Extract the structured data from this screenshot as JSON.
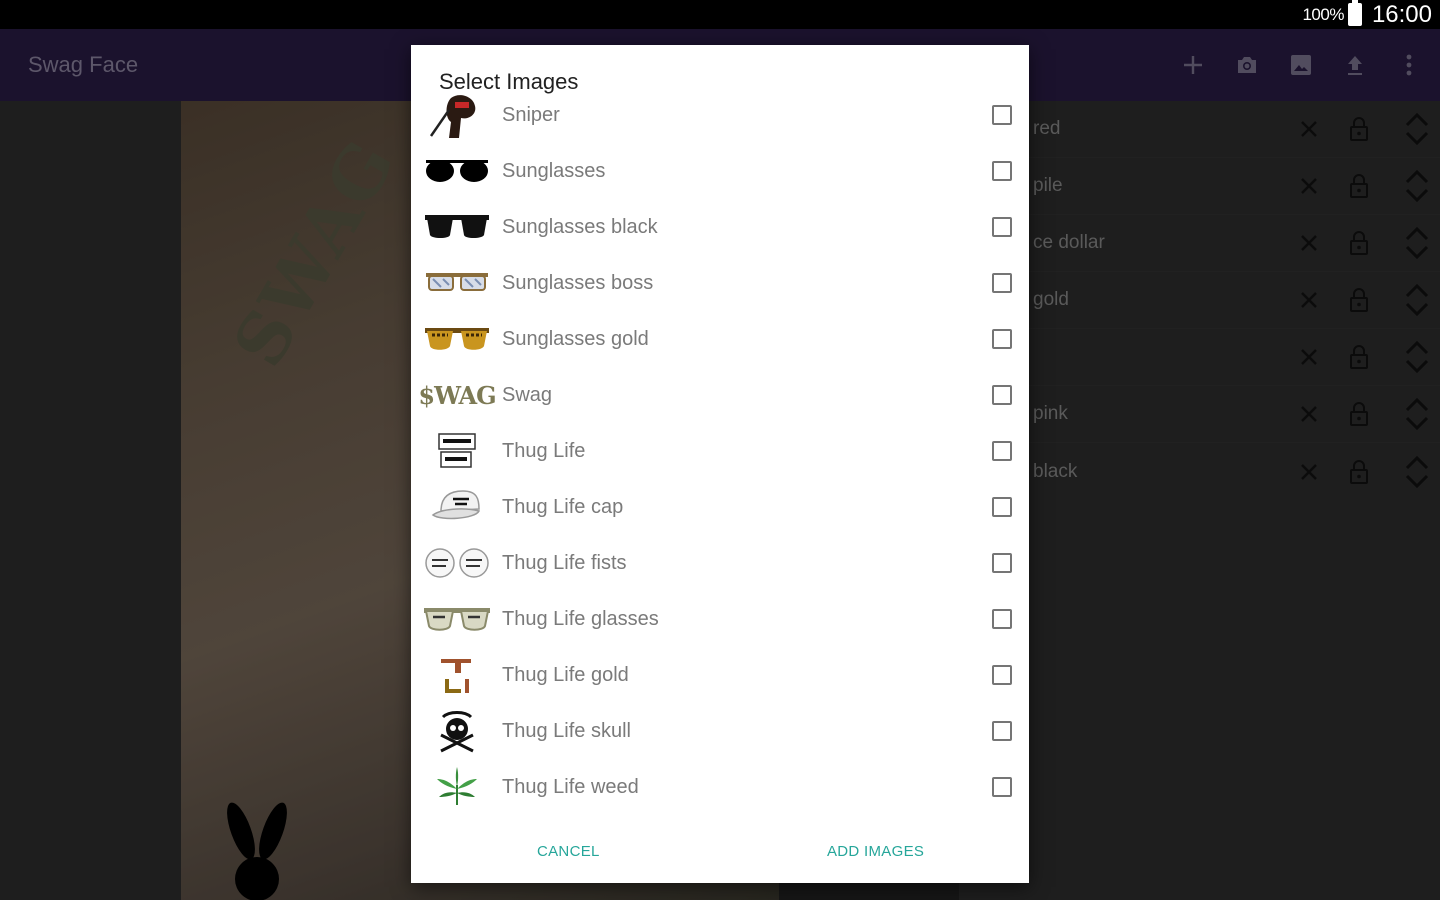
{
  "status_bar": {
    "battery": "100%",
    "time": "16:00"
  },
  "app_bar": {
    "title": "Swag Face",
    "actions": [
      "add-icon",
      "camera-icon",
      "gallery-icon",
      "upload-icon",
      "overflow-menu-icon"
    ]
  },
  "background": {
    "photo_text": "SWAG",
    "layers": [
      {
        "label": "red"
      },
      {
        "label": "pile"
      },
      {
        "label": "ce dollar"
      },
      {
        "label": "gold"
      },
      {
        "label": ""
      },
      {
        "label": "pink"
      },
      {
        "label": "black"
      }
    ]
  },
  "dialog": {
    "title": "Select Images",
    "items": [
      {
        "label": "Sniper",
        "icon": "sniper-icon",
        "checked": false
      },
      {
        "label": "Sunglasses",
        "icon": "sunglasses-icon",
        "checked": false
      },
      {
        "label": "Sunglasses black",
        "icon": "sunglasses-black-icon",
        "checked": false
      },
      {
        "label": "Sunglasses boss",
        "icon": "sunglasses-boss-icon",
        "checked": false
      },
      {
        "label": "Sunglasses gold",
        "icon": "sunglasses-gold-icon",
        "checked": false
      },
      {
        "label": "Swag",
        "icon": "swag-text-icon",
        "thumb_text": "$WAG",
        "checked": false
      },
      {
        "label": "Thug Life",
        "icon": "thug-life-icon",
        "checked": false
      },
      {
        "label": "Thug Life cap",
        "icon": "thug-life-cap-icon",
        "checked": false
      },
      {
        "label": "Thug Life fists",
        "icon": "thug-life-fists-icon",
        "checked": false
      },
      {
        "label": "Thug Life glasses",
        "icon": "thug-life-glasses-icon",
        "checked": false
      },
      {
        "label": "Thug Life gold",
        "icon": "thug-life-gold-icon",
        "checked": false
      },
      {
        "label": "Thug Life skull",
        "icon": "thug-life-skull-icon",
        "checked": false
      },
      {
        "label": "Thug Life weed",
        "icon": "thug-life-weed-icon",
        "checked": false
      }
    ],
    "cancel_label": "CANCEL",
    "add_label": "ADD IMAGES"
  },
  "colors": {
    "accent": "#26a69a",
    "app_bar": "#4a3380"
  }
}
